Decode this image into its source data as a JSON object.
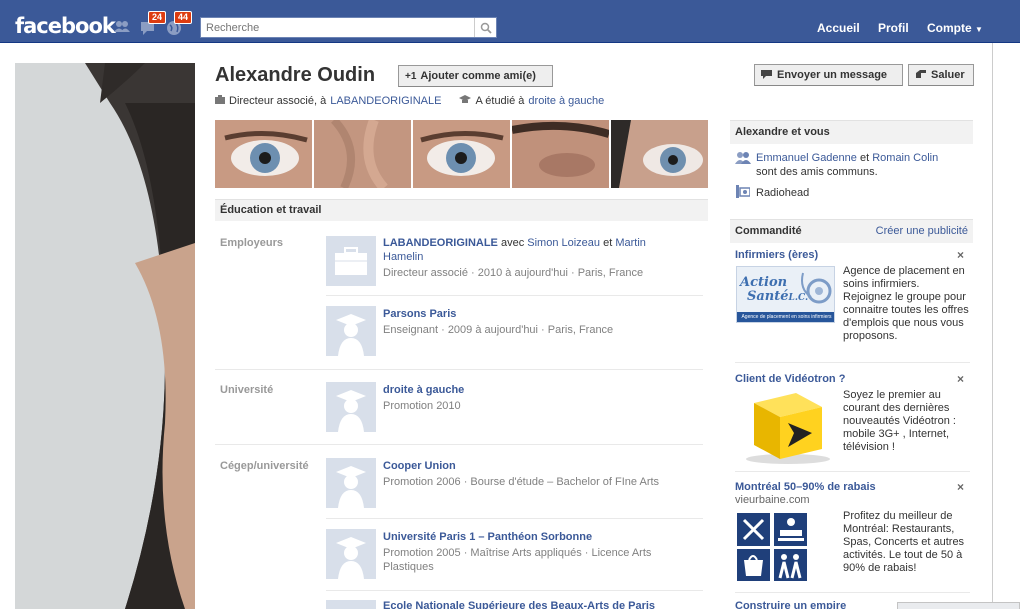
{
  "header": {
    "logo": "facebook",
    "messages_count": "24",
    "notifications_count": "44",
    "search_placeholder": "Recherche",
    "nav": [
      "Accueil",
      "Profil",
      "Compte"
    ]
  },
  "profile": {
    "name": "Alexandre Oudin",
    "add_friend": "Ajouter comme ami(e)",
    "send_message": "Envoyer un message",
    "poke": "Saluer",
    "job_prefix": "Directeur associé, à",
    "job_company": "LABANDEORIGINALE",
    "edu_prefix": "A étudié à",
    "edu_school": "droite à gauche"
  },
  "education_work": {
    "title": "Éducation et travail",
    "employers_label": "Employeurs",
    "university_label": "Université",
    "cegep_label": "Cégep/université",
    "employers": [
      {
        "name": "LABANDEORIGINALE",
        "with": "avec",
        "person1": "Simon Loizeau",
        "and": "et",
        "person2_line1": "Martin",
        "person2_line2": "Hamelin",
        "details": "Directeur associé · 2010 à aujourd'hui · Paris, France"
      },
      {
        "name": "Parsons Paris",
        "details": "Enseignant · 2009 à aujourd'hui · Paris, France"
      }
    ],
    "university": {
      "name": "droite à gauche",
      "details": "Promotion 2010"
    },
    "cegep": [
      {
        "name": "Cooper Union",
        "details": "Promotion 2006 · Bourse d'étude – Bachelor of FIne Arts"
      },
      {
        "name": "Université Paris 1 – Panthéon Sorbonne",
        "details": "Promotion 2005 · Maîtrise Arts appliqués · Licence Arts Plastiques"
      },
      {
        "name": "Ecole Nationale Supérieure des Beaux-Arts de Paris"
      }
    ]
  },
  "sidebar": {
    "mutual_title": "Alexandre et vous",
    "mutual_friend1": "Emmanuel Gadenne",
    "mutual_and": "et",
    "mutual_friend2": "Romain Colin",
    "mutual_suffix": "sont des amis communs.",
    "mutual_like": "Radiohead",
    "sponsored_title": "Commandité",
    "create_ad": "Créer une publicité",
    "ads": [
      {
        "title": "Infirmiers (ères)",
        "body": "Agence de placement en soins infirmiers. Rejoignez le groupe pour connaitre toutes les offres d'emplois que nous vous proposons.",
        "image_logo_1": "Action",
        "image_logo_2": "Santé",
        "image_logo_3": "L.C.",
        "image_caption": "Agence de placement en soins infirmiers"
      },
      {
        "title": "Client de Vidéotron ?",
        "body": "Soyez le premier au courant des dernières nouveautés Vidéotron : mobile 3G+ , Internet, télévision !"
      },
      {
        "title": "Montréal 50–90% de rabais",
        "subtitle": "vieurbaine.com",
        "body": "Profitez du meilleur de Montréal: Restaurants, Spas, Concerts et autres activités. Le tout de 50 à 90% de rabais!"
      },
      {
        "title": "Construire un empire"
      }
    ]
  },
  "colors": {
    "brand": "#3b5998",
    "badge": "#dd3c10"
  }
}
